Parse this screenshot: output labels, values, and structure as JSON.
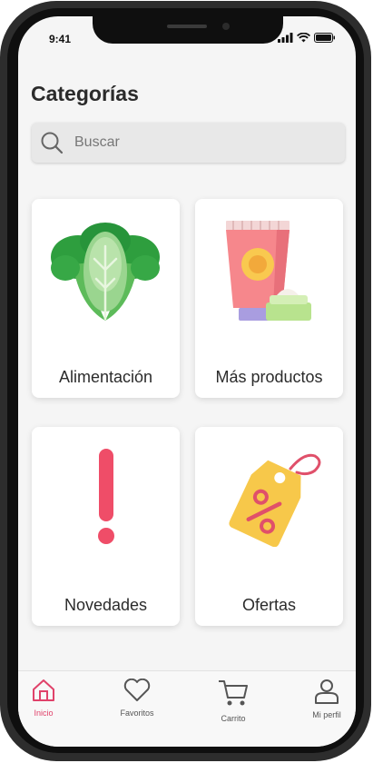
{
  "status_bar": {
    "time": "9:41"
  },
  "page": {
    "title": "Categorías"
  },
  "search": {
    "placeholder": "Buscar"
  },
  "categories": [
    {
      "label": "Alimentación",
      "icon": "lettuce-icon"
    },
    {
      "label": "Más productos",
      "icon": "cream-tube-icon"
    },
    {
      "label": "Novedades",
      "icon": "exclamation-icon"
    },
    {
      "label": "Ofertas",
      "icon": "discount-tag-icon"
    }
  ],
  "tabbar": {
    "items": [
      {
        "label": "Inicio",
        "icon": "home-icon",
        "active": true
      },
      {
        "label": "Favoritos",
        "icon": "heart-icon",
        "active": false
      },
      {
        "label": "Carrito",
        "icon": "cart-icon",
        "active": false
      },
      {
        "label": "Mi perfil",
        "icon": "user-icon",
        "active": false
      }
    ]
  },
  "colors": {
    "accent": "#e0426a",
    "text": "#2b2b2b",
    "background": "#f5f5f5"
  }
}
